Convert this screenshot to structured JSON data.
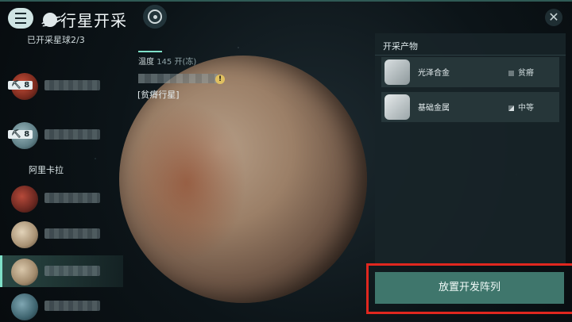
{
  "header": {
    "title": "行星开采"
  },
  "sidebar": {
    "mined_count": "已开采星球2/3",
    "badges": [
      "8",
      "8"
    ],
    "section_label": "阿里卡拉"
  },
  "planet": {
    "temp_label": "温度",
    "temp_value": "145 开(冻)",
    "warn_symbol": "!",
    "type": "[贫瘠行星]"
  },
  "panel": {
    "title": "开采产物",
    "resources": [
      {
        "name": "光泽合金",
        "grade": "贫瘠",
        "icon": "alloy-icon"
      },
      {
        "name": "基础金属",
        "grade": "中等",
        "icon": "metal-icon"
      }
    ]
  },
  "actions": {
    "deploy_label": "放置开发阵列"
  },
  "colors": {
    "accent": "#7fe0c8",
    "cta": "#3f766c",
    "highlight": "#e0271f"
  }
}
